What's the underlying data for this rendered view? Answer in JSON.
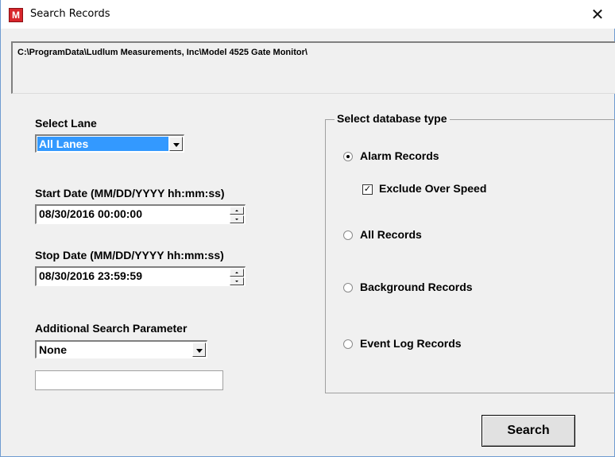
{
  "window": {
    "title": "Search Records",
    "close_glyph": "✕",
    "app_icon_letter": "M"
  },
  "path": "C:\\ProgramData\\Ludlum Measurements, Inc\\Model 4525 Gate Monitor\\",
  "lane": {
    "label": "Select Lane",
    "value": "All Lanes"
  },
  "start_date": {
    "label": "Start Date  (MM/DD/YYYY hh:mm:ss)",
    "value": "08/30/2016  00:00:00"
  },
  "stop_date": {
    "label": "Stop Date  (MM/DD/YYYY hh:mm:ss)",
    "value": "08/30/2016  23:59:59"
  },
  "additional": {
    "label": "Additional Search Parameter",
    "value": "None",
    "text_value": ""
  },
  "db_type": {
    "title": "Select database type",
    "options": [
      {
        "label": "Alarm Records",
        "checked": true
      },
      {
        "label": "All Records",
        "checked": false
      },
      {
        "label": "Background Records",
        "checked": false
      },
      {
        "label": "Event Log Records",
        "checked": false
      }
    ],
    "exclude_over_speed": {
      "label": "Exclude Over Speed",
      "checked": true,
      "mark": "✓"
    }
  },
  "search_button": "Search",
  "colors": {
    "selection": "#3399ff",
    "window_bg": "#f0f0f0",
    "app_icon": "#d8252b"
  }
}
